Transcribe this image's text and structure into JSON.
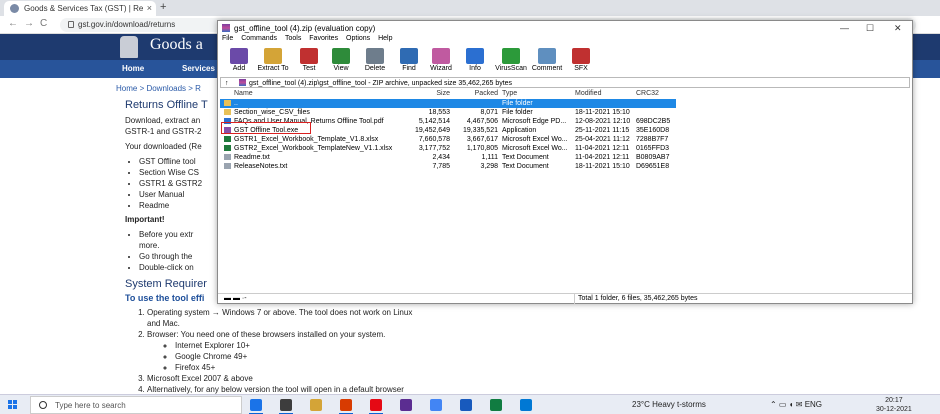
{
  "browser": {
    "tab_title": "Goods & Services Tax (GST) | Re",
    "tab_close": "×",
    "new_tab": "+",
    "url": "gst.gov.in/download/returns",
    "back": "←",
    "forward": "→",
    "reload": "C"
  },
  "site": {
    "title": "Goods a",
    "nav": [
      "Home",
      "Services"
    ],
    "breadcrumb": "Home  >  Downloads  >  R",
    "heading": "Returns Offline T",
    "intro": "Download, extract an",
    "intro2": "GSTR-1 and GSTR-2",
    "downloaded": "Your downloaded (Re",
    "bullets": [
      "GST Offline tool",
      "Section Wise CS",
      "GSTR1 & GSTR2",
      "User Manual",
      "Readme"
    ],
    "important": "Important!",
    "important_items": [
      "Before you extr",
      "more.",
      "Go through the",
      "Double-click on"
    ],
    "requirements_heading": "System Requirer",
    "requirements_sub": "To use the tool effi",
    "req_items": [
      "Operating system → Windows 7 or above. The tool does not work on Linux and Mac.",
      "Browser: You need one of these browsers installed on your system."
    ],
    "browsers": [
      "Internet Explorer 10+",
      "Google Chrome 49+",
      "Firefox 45+"
    ],
    "req_items2": [
      "Microsoft Excel 2007 & above",
      "Alternatively, for any below version the tool will open in a default browser"
    ]
  },
  "rar": {
    "title": "gst_offline_tool (4).zip (evaluation copy)",
    "win_buttons": [
      "—",
      "☐",
      "✕"
    ],
    "menu": [
      "File",
      "Commands",
      "Tools",
      "Favorites",
      "Options",
      "Help"
    ],
    "tools": [
      {
        "label": "Add",
        "color": "#6b4aa8"
      },
      {
        "label": "Extract To",
        "color": "#d4a437"
      },
      {
        "label": "Test",
        "color": "#c03030"
      },
      {
        "label": "View",
        "color": "#2e8b3a"
      },
      {
        "label": "Delete",
        "color": "#6e7d8c"
      },
      {
        "label": "Find",
        "color": "#2f6bb3"
      },
      {
        "label": "Wizard",
        "color": "#c05aa0"
      },
      {
        "label": "Info",
        "color": "#2b6fd1"
      },
      {
        "label": "VirusScan",
        "color": "#2c9a3a"
      },
      {
        "label": "Comment",
        "color": "#5f8fbf"
      },
      {
        "label": "SFX",
        "color": "#c03030"
      }
    ],
    "path": "gst_offline_tool (4).zip\\gst_offline_tool - ZIP archive, unpacked size 35,462,265 bytes",
    "up_arrow": "↑",
    "columns": [
      "Name",
      "Size",
      "Packed",
      "Type",
      "Modified",
      "CRC32"
    ],
    "files": [
      {
        "name": "..",
        "size": "",
        "packed": "",
        "type": "File folder",
        "modified": "",
        "crc": "",
        "icon_color": "#e8c158",
        "selected": true
      },
      {
        "name": "Section_wise_CSV_files",
        "size": "18,553",
        "packed": "8,071",
        "type": "File folder",
        "modified": "18-11-2021 15:10",
        "crc": "",
        "icon_color": "#e8c158",
        "selected": false
      },
      {
        "name": "FAQs and User Manual, Returns Offline Tool.pdf",
        "size": "5,142,514",
        "packed": "4,467,506",
        "type": "Microsoft Edge PD...",
        "modified": "12-08-2021 12:10",
        "crc": "698DC2B5",
        "icon_color": "#2a6fd1",
        "selected": false
      },
      {
        "name": "GST Offline Tool.exe",
        "size": "19,452,649",
        "packed": "19,335,521",
        "type": "Application",
        "modified": "25-11-2021 11:15",
        "crc": "35E160D8",
        "icon_color": "#8a4fa8",
        "selected": false
      },
      {
        "name": "GSTR1_Excel_Workbook_Template_V1.8.xlsx",
        "size": "7,660,578",
        "packed": "3,667,617",
        "type": "Microsoft Excel Wo...",
        "modified": "25-04-2021 11:12",
        "crc": "7288B7F7",
        "icon_color": "#1f7a3c",
        "selected": false
      },
      {
        "name": "GSTR2_Excel_Workbook_TemplateNew_V1.1.xlsx",
        "size": "3,177,752",
        "packed": "1,170,805",
        "type": "Microsoft Excel Wo...",
        "modified": "11-04-2021 12:11",
        "crc": "0165FFD3",
        "icon_color": "#1f7a3c",
        "selected": false
      },
      {
        "name": "Readme.txt",
        "size": "2,434",
        "packed": "1,111",
        "type": "Text Document",
        "modified": "11-04-2021 12:11",
        "crc": "B0809AB7",
        "icon_color": "#9aa4b0",
        "selected": false
      },
      {
        "name": "ReleaseNotes.txt",
        "size": "7,785",
        "packed": "3,298",
        "type": "Text Document",
        "modified": "18-11-2021 15:10",
        "crc": "D69651E8",
        "icon_color": "#9aa4b0",
        "selected": false
      }
    ],
    "status_left": "▬ ▬ ·-",
    "status_right": "Total 1 folder, 6 files, 35,462,265 bytes"
  },
  "taskbar": {
    "search_placeholder": "Type here to search",
    "apps": [
      "#1a73e8",
      "#3d3d3d",
      "#d4a437",
      "#d83b01",
      "#e50914",
      "#5b2d91",
      "#4285f4",
      "#185abd",
      "#107c41",
      "#0078d4"
    ],
    "weather": "23°C  Heavy t-storms",
    "tray_icons": "⌃ ▭ ◖ ✉  ENG",
    "time": "20:17",
    "date": "30-12-2021"
  }
}
